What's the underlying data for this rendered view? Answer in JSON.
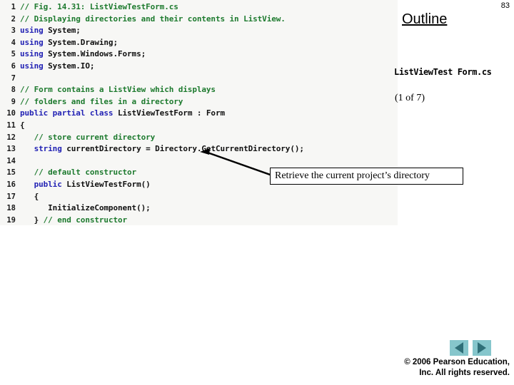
{
  "slide": {
    "number": "83",
    "outline_heading": "Outline",
    "filename": "ListViewTest Form.cs",
    "progress": "(1 of 7)"
  },
  "code": {
    "lines": [
      {
        "n": "1",
        "tokens": [
          {
            "t": "comment",
            "s": "// Fig. 14.31: ListViewTestForm.cs"
          }
        ]
      },
      {
        "n": "2",
        "tokens": [
          {
            "t": "comment",
            "s": "// Displaying directories and their contents in ListView."
          }
        ]
      },
      {
        "n": "3",
        "tokens": [
          {
            "t": "keyword",
            "s": "using "
          },
          {
            "t": "plain",
            "s": "System;"
          }
        ]
      },
      {
        "n": "4",
        "tokens": [
          {
            "t": "keyword",
            "s": "using "
          },
          {
            "t": "plain",
            "s": "System.Drawing;"
          }
        ]
      },
      {
        "n": "5",
        "tokens": [
          {
            "t": "keyword",
            "s": "using "
          },
          {
            "t": "plain",
            "s": "System.Windows.Forms;"
          }
        ]
      },
      {
        "n": "6",
        "tokens": [
          {
            "t": "keyword",
            "s": "using "
          },
          {
            "t": "plain",
            "s": "System.IO;"
          }
        ]
      },
      {
        "n": "7",
        "tokens": [
          {
            "t": "plain",
            "s": ""
          }
        ]
      },
      {
        "n": "8",
        "tokens": [
          {
            "t": "comment",
            "s": "// Form contains a ListView which displays"
          }
        ]
      },
      {
        "n": "9",
        "tokens": [
          {
            "t": "comment",
            "s": "// folders and files in a directory"
          }
        ]
      },
      {
        "n": "10",
        "tokens": [
          {
            "t": "keyword",
            "s": "public partial class "
          },
          {
            "t": "plain",
            "s": "ListViewTestForm : Form"
          }
        ]
      },
      {
        "n": "11",
        "tokens": [
          {
            "t": "plain",
            "s": "{"
          }
        ]
      },
      {
        "n": "12",
        "tokens": [
          {
            "t": "plain",
            "s": "   "
          },
          {
            "t": "comment",
            "s": "// store current directory"
          }
        ]
      },
      {
        "n": "13",
        "tokens": [
          {
            "t": "plain",
            "s": "   "
          },
          {
            "t": "keyword",
            "s": "string "
          },
          {
            "t": "plain",
            "s": "currentDirectory = Directory.GetCurrentDirectory();"
          }
        ]
      },
      {
        "n": "14",
        "tokens": [
          {
            "t": "plain",
            "s": ""
          }
        ]
      },
      {
        "n": "15",
        "tokens": [
          {
            "t": "plain",
            "s": "   "
          },
          {
            "t": "comment",
            "s": "// default constructor"
          }
        ]
      },
      {
        "n": "16",
        "tokens": [
          {
            "t": "plain",
            "s": "   "
          },
          {
            "t": "keyword",
            "s": "public "
          },
          {
            "t": "plain",
            "s": "ListViewTestForm()"
          }
        ]
      },
      {
        "n": "17",
        "tokens": [
          {
            "t": "plain",
            "s": "   {"
          }
        ]
      },
      {
        "n": "18",
        "tokens": [
          {
            "t": "plain",
            "s": "      InitializeComponent();"
          }
        ]
      },
      {
        "n": "19",
        "tokens": [
          {
            "t": "plain",
            "s": "   } "
          },
          {
            "t": "comment",
            "s": "// end constructor"
          }
        ]
      }
    ]
  },
  "callout": {
    "text": "Retrieve the current project’s directory"
  },
  "footer": {
    "prev_label": "Previous slide",
    "next_label": "Next slide",
    "copyright_line1": "© 2006 Pearson Education,",
    "copyright_line2": "Inc.  All rights reserved."
  },
  "colors": {
    "code_background": "#f7f7f5",
    "comment": "#1d7a2e",
    "keyword": "#2222b4",
    "nav_button_bg": "#86c6cc",
    "nav_arrow": "#2f6f78"
  }
}
